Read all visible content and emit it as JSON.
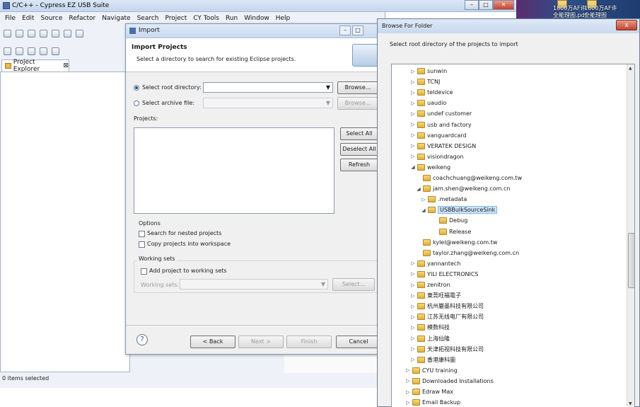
{
  "eclipse": {
    "title": "C/C++ - Cypress EZ USB Suite",
    "menu": [
      "File",
      "Edit",
      "Source",
      "Refactor",
      "Navigate",
      "Search",
      "Project",
      "CY Tools",
      "Run",
      "Window",
      "Help"
    ],
    "explorer_tab": "Project Explorer",
    "explorer_tab_close": "⊠",
    "status": "0 items selected"
  },
  "desktop": {
    "labels": [
      "1800万AF许",
      "1800万AF许",
      "全能理图.pdf",
      "全能理图"
    ]
  },
  "import": {
    "window_title": "Import",
    "heading": "Import Projects",
    "subheading": "Select a directory to search for existing Eclipse projects.",
    "root_dir_label": "Select root directory:",
    "archive_label": "Select archive file:",
    "browse_label": "Browse...",
    "browse2_label": "Browse...",
    "projects_label": "Projects:",
    "select_all": "Select All",
    "deselect_all": "Deselect All",
    "refresh": "Refresh",
    "options_title": "Options",
    "search_nested": "Search for nested projects",
    "copy_projects": "Copy projects into workspace",
    "working_sets_title": "Working sets",
    "add_to_ws": "Add project to working sets",
    "working_sets_label": "Working sets:",
    "select_ws": "Select...",
    "help_icon": "?",
    "back": "< Back",
    "next": "Next >",
    "finish": "Finish",
    "cancel": "Cancel"
  },
  "browse": {
    "title": "Browse For Folder",
    "close_label": "x",
    "message": "Select root directory of the projects to import",
    "tree": [
      {
        "label": "sunwin",
        "level": 1,
        "expander": "▷"
      },
      {
        "label": "TCNJ",
        "level": 1,
        "expander": "▷"
      },
      {
        "label": "teldevice",
        "level": 1,
        "expander": "▷"
      },
      {
        "label": "uaudio",
        "level": 1,
        "expander": "▷"
      },
      {
        "label": "undef customer",
        "level": 1,
        "expander": "▷"
      },
      {
        "label": "usb and factory",
        "level": 1,
        "expander": "▷"
      },
      {
        "label": "vanguardcard",
        "level": 1,
        "expander": "▷"
      },
      {
        "label": "VERATEK DESIGN",
        "level": 1,
        "expander": "▷"
      },
      {
        "label": "visiondragon",
        "level": 1,
        "expander": "▷"
      },
      {
        "label": "weikeng",
        "level": 1,
        "expander": "◢"
      },
      {
        "label": "coachchuang@weikeng.com.tw",
        "level": 2,
        "expander": ""
      },
      {
        "label": "jam.shen@weikeng.com.cn",
        "level": 2,
        "expander": "◢"
      },
      {
        "label": ".metadata",
        "level": 3,
        "expander": "▷"
      },
      {
        "label": "USBBulkSourceSink",
        "level": 3,
        "expander": "◢",
        "selected": true
      },
      {
        "label": "Debug",
        "level": 4,
        "expander": ""
      },
      {
        "label": "Release",
        "level": 4,
        "expander": ""
      },
      {
        "label": "kylel@weikeng.com.tw",
        "level": 2,
        "expander": ""
      },
      {
        "label": "taylor.zhang@weikeng.com.cn",
        "level": 2,
        "expander": ""
      },
      {
        "label": "yannantech",
        "level": 1,
        "expander": "▷"
      },
      {
        "label": "YILI ELECTRONICS",
        "level": 1,
        "expander": "▷"
      },
      {
        "label": "zenitron",
        "level": 1,
        "expander": "▷"
      },
      {
        "label": "東莞旺福電子",
        "level": 1,
        "expander": "▷"
      },
      {
        "label": "杭州巖墨科技有限公司",
        "level": 1,
        "expander": "▷"
      },
      {
        "label": "江苏无线电厂有限公司",
        "level": 1,
        "expander": "▷"
      },
      {
        "label": "模数科技",
        "level": 1,
        "expander": "▷"
      },
      {
        "label": "上海仙隆",
        "level": 1,
        "expander": "▷"
      },
      {
        "label": "天津拓视科技有限公司",
        "level": 1,
        "expander": "▷"
      },
      {
        "label": "香港康科圖",
        "level": 1,
        "expander": "▷"
      },
      {
        "label": "CYU training",
        "level": 0,
        "expander": "▷"
      },
      {
        "label": "Downloaded Installations",
        "level": 0,
        "expander": "▷"
      },
      {
        "label": "Edraw Max",
        "level": 0,
        "expander": "▷"
      },
      {
        "label": "Email Backup",
        "level": 0,
        "expander": "▷"
      }
    ]
  }
}
